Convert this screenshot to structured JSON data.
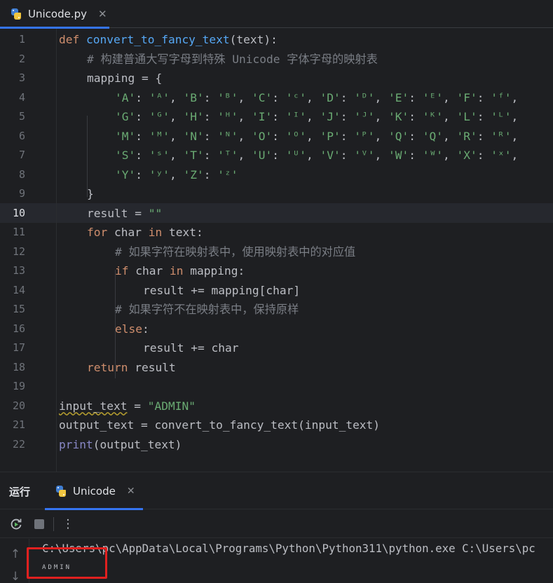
{
  "editor_tab": {
    "title": "Unicode.py",
    "close": "✕",
    "icon": "python-icon"
  },
  "line_numbers": [
    "1",
    "2",
    "3",
    "4",
    "5",
    "6",
    "7",
    "8",
    "9",
    "10",
    "11",
    "12",
    "13",
    "14",
    "15",
    "16",
    "17",
    "18",
    "19",
    "20",
    "21",
    "22"
  ],
  "current_line": "10",
  "code": {
    "l1": {
      "kw": "def",
      "fn": "convert_to_fancy_text",
      "rest": "(text):"
    },
    "l2": {
      "comment": "# 构建普通大写字母到特殊 Unicode 字体字母的映射表"
    },
    "l3": {
      "text": "mapping = {"
    },
    "l4": [
      {
        "k": "'A'",
        "v": "'ᴬ'"
      },
      {
        "k": "'B'",
        "v": "'ᴮ'"
      },
      {
        "k": "'C'",
        "v": "'ᶜ'"
      },
      {
        "k": "'D'",
        "v": "'ᴰ'"
      },
      {
        "k": "'E'",
        "v": "'ᴱ'"
      },
      {
        "k": "'F'",
        "v": "'ᶠ'"
      }
    ],
    "l5": [
      {
        "k": "'G'",
        "v": "'ᴳ'"
      },
      {
        "k": "'H'",
        "v": "'ᴴ'"
      },
      {
        "k": "'I'",
        "v": "'ᴵ'"
      },
      {
        "k": "'J'",
        "v": "'ᴶ'"
      },
      {
        "k": "'K'",
        "v": "'ᴷ'"
      },
      {
        "k": "'L'",
        "v": "'ᴸ'"
      }
    ],
    "l6": [
      {
        "k": "'M'",
        "v": "'ᴹ'"
      },
      {
        "k": "'N'",
        "v": "'ᴺ'"
      },
      {
        "k": "'O'",
        "v": "'ᴼ'"
      },
      {
        "k": "'P'",
        "v": "'ᴾ'"
      },
      {
        "k": "'Q'",
        "v": "'Q'"
      },
      {
        "k": "'R'",
        "v": "'ᴿ'"
      }
    ],
    "l7": [
      {
        "k": "'S'",
        "v": "'ˢ'"
      },
      {
        "k": "'T'",
        "v": "'ᵀ'"
      },
      {
        "k": "'U'",
        "v": "'ᵁ'"
      },
      {
        "k": "'V'",
        "v": "'ⱽ'"
      },
      {
        "k": "'W'",
        "v": "'ᵂ'"
      },
      {
        "k": "'X'",
        "v": "'ˣ'"
      }
    ],
    "l8": [
      {
        "k": "'Y'",
        "v": "'ʸ'"
      },
      {
        "k": "'Z'",
        "v": "'ᶻ'"
      }
    ],
    "l9": {
      "text": "}"
    },
    "l10": {
      "a": "result = ",
      "str": "\"\""
    },
    "l11": {
      "kw1": "for",
      "a": " char ",
      "kw2": "in",
      "b": " text:"
    },
    "l12": {
      "comment": "# 如果字符在映射表中，使用映射表中的对应值"
    },
    "l13": {
      "kw1": "if",
      "a": " char ",
      "kw2": "in",
      "b": " mapping:"
    },
    "l14": {
      "text": "result += mapping[char]"
    },
    "l15": {
      "comment": "# 如果字符不在映射表中，保持原样"
    },
    "l16": {
      "kw": "else",
      "rest": ":"
    },
    "l17": {
      "text": "result += char"
    },
    "l18": {
      "kw": "return",
      "rest": " result"
    },
    "l20": {
      "var": "input_text",
      "eq": " = ",
      "str": "\"ADMIN\""
    },
    "l21": {
      "text": "output_text = convert_to_fancy_text(input_text)"
    },
    "l22": {
      "bi": "print",
      "rest": "(output_text)"
    }
  },
  "run_panel": {
    "label": "运行",
    "tab_title": "Unicode",
    "tab_close": "✕",
    "toolbar": {
      "rerun_icon": "rerun-icon",
      "stop_icon": "stop-icon",
      "more": "⋮"
    },
    "console_line1": "C:\\Users\\pc\\AppData\\Local\\Programs\\Python\\Python311\\python.exe C:\\Users\\pc",
    "console_line2": "ADMIN",
    "up_arrow": "↑",
    "down_arrow": "↓"
  },
  "colors": {
    "accent": "#3574f0",
    "keyword": "#cf8e6d",
    "function": "#56a8f5",
    "string": "#6aab73",
    "comment": "#7a7e85",
    "highlight_box": "#e0201f"
  }
}
